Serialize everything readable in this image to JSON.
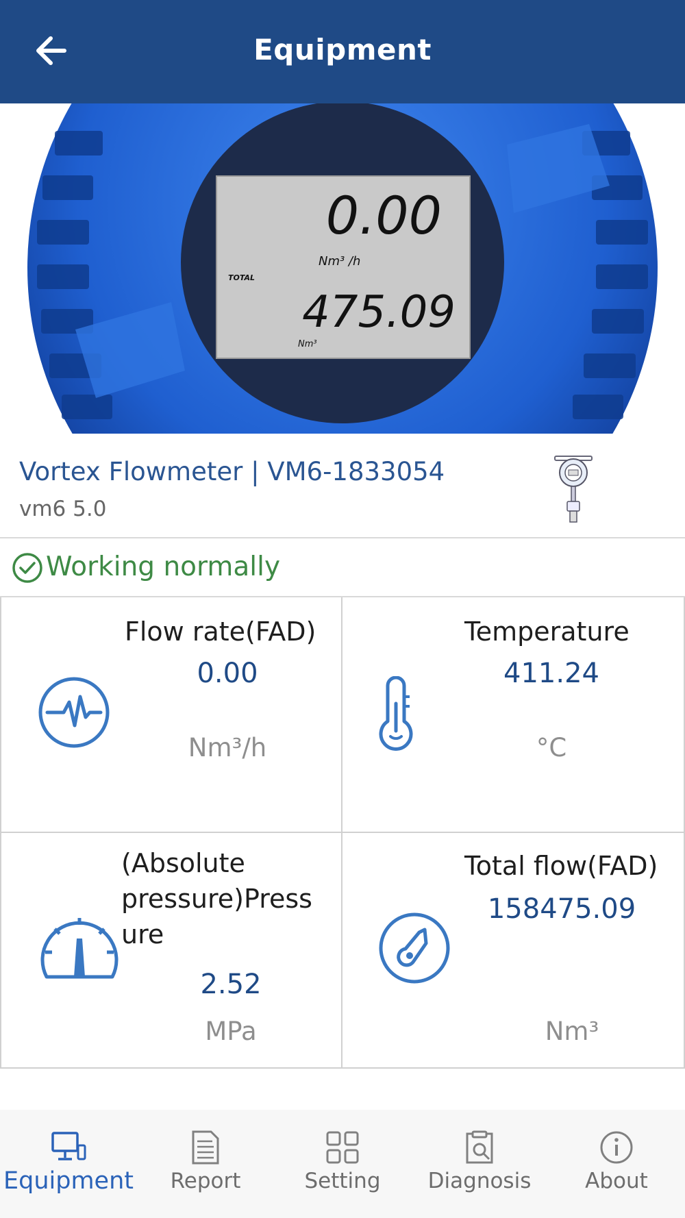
{
  "header": {
    "title": "Equipment"
  },
  "meter_display": {
    "flow_value": "0.00",
    "flow_unit": "Nm³ /h",
    "total_label": "TOTAL",
    "total_value": "475.09",
    "total_unit": "Nm³"
  },
  "device": {
    "name": "Vortex Flowmeter  | VM6-1833054",
    "version": "vm6 5.0"
  },
  "status": {
    "text": "Working normally",
    "color": "#3e8a45"
  },
  "metrics": {
    "flow_rate": {
      "label": "Flow rate(FAD)",
      "value": "0.00",
      "unit": "Nm³/h",
      "icon": "pulse-icon"
    },
    "temperature": {
      "label": "Temperature",
      "value": "411.24",
      "unit": "°C",
      "icon": "thermometer-icon"
    },
    "pressure": {
      "label_line1": "(Absolute",
      "label_line2": "pressure)Press",
      "label_line3": "ure",
      "value": "2.52",
      "unit": "MPa",
      "icon": "gauge-icon"
    },
    "total_flow": {
      "label": "Total flow(FAD)",
      "value": "158475.09",
      "unit": "Nm³",
      "icon": "flow-meter-icon"
    }
  },
  "nav": {
    "items": [
      {
        "label": "Equipment",
        "icon": "monitor-icon",
        "active": true
      },
      {
        "label": "Report",
        "icon": "document-icon",
        "active": false
      },
      {
        "label": "Setting",
        "icon": "grid-icon",
        "active": false
      },
      {
        "label": "Diagnosis",
        "icon": "clipboard-search-icon",
        "active": false
      },
      {
        "label": "About",
        "icon": "info-icon",
        "active": false
      }
    ]
  },
  "colors": {
    "header": "#1f4a86",
    "accent": "#2a62b8",
    "value": "#1f4a86",
    "icon": "#3a78c2"
  }
}
